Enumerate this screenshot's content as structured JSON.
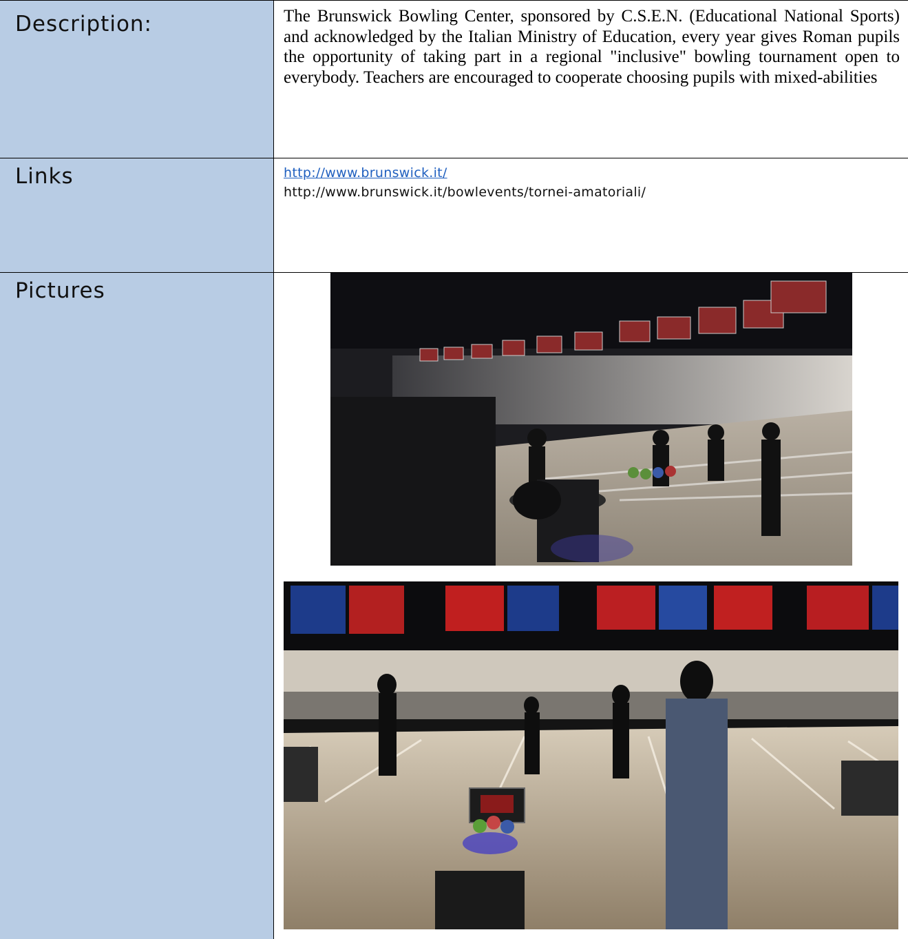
{
  "rows": {
    "description": {
      "label": "Description:",
      "text": "The Brunswick Bowling Center, sponsored by C.S.E.N. (Educational National Sports) and acknowledged by the Italian Ministry of Education, every year gives  Roman pupils the opportunity of taking part in a regional \"inclusive\" bowling tournament open to everybody. Teachers are encouraged to cooperate choosing pupils with mixed-abilities"
    },
    "links": {
      "label": "Links",
      "link1": "http://www.brunswick.it/",
      "link2": "http://www.brunswick.it/bowlevents/tornei-amatoriali/"
    },
    "pictures": {
      "label": "Pictures",
      "photos": [
        "bowling-photo-1",
        "bowling-photo-2"
      ]
    }
  },
  "colors": {
    "label_bg": "#b8cce4",
    "link": "#1f5fbf",
    "border": "#000000"
  }
}
